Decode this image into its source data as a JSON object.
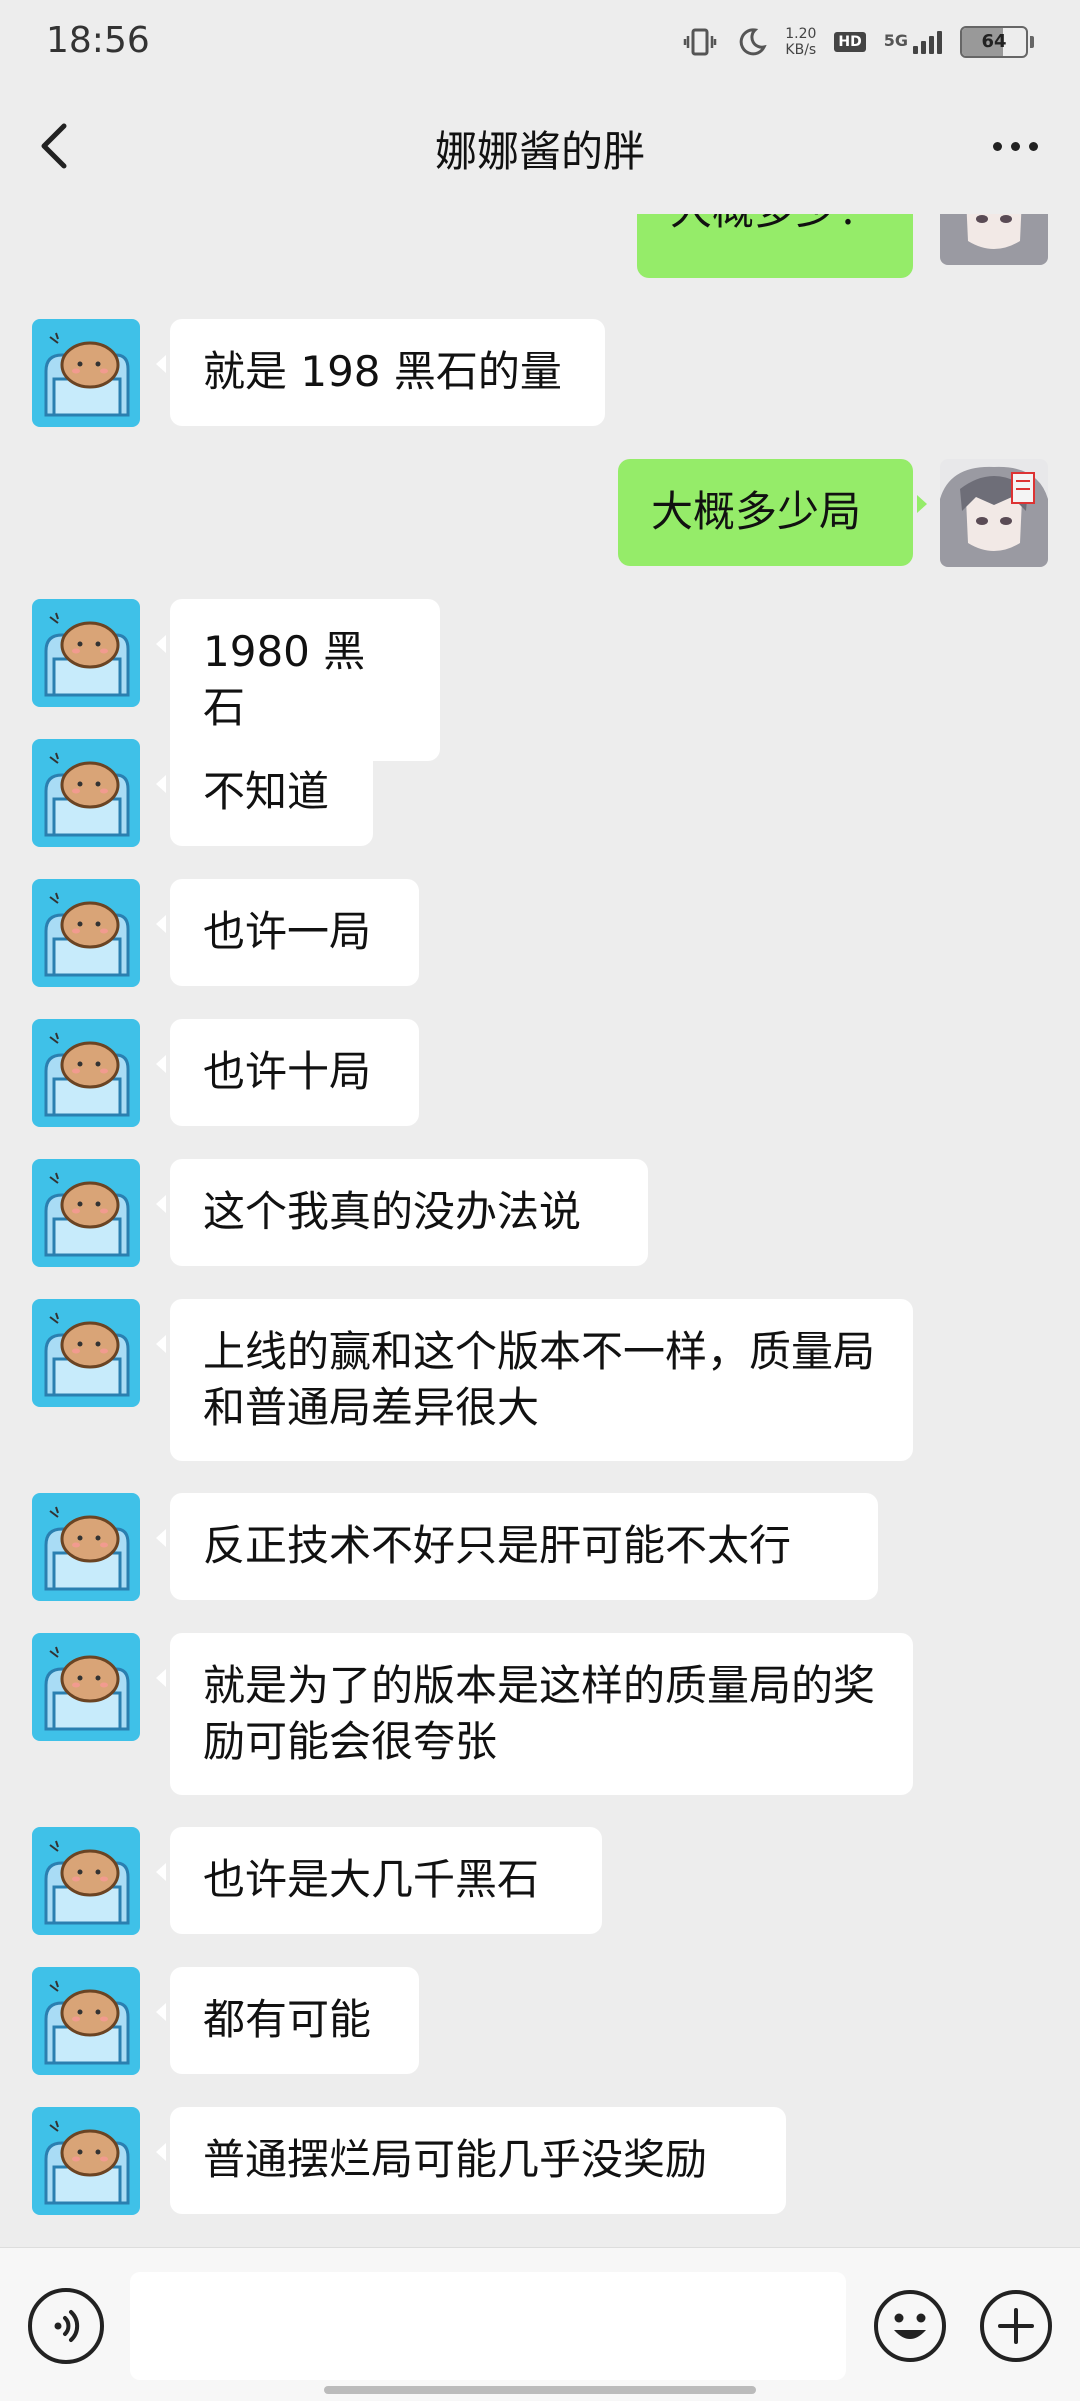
{
  "status": {
    "time": "18:56",
    "speed_value": "1.20",
    "speed_unit": "KB/s",
    "hd": "HD",
    "network": "5G",
    "battery": "64",
    "battery_level": 0.64
  },
  "header": {
    "title": "娜娜酱的胖",
    "back_icon": "chevron-left-icon",
    "more_icon": "more-dots-icon"
  },
  "messages": [
    {
      "side": "out",
      "text": "大概多少？"
    },
    {
      "side": "in",
      "text": "就是 198 黑石的量"
    },
    {
      "side": "out",
      "text": "大概多少局"
    },
    {
      "side": "in",
      "text": "1980 黑石"
    },
    {
      "side": "in",
      "text": "不知道"
    },
    {
      "side": "in",
      "text": "也许一局"
    },
    {
      "side": "in",
      "text": "也许十局"
    },
    {
      "side": "in",
      "text": "这个我真的没办法说"
    },
    {
      "side": "in",
      "text": "上线的赢和这个版本不一样，质量局和普通局差异很大"
    },
    {
      "side": "in",
      "text": "反正技术不好只是肝可能不太行"
    },
    {
      "side": "in",
      "text": "就是为了的版本是这样的质量局的奖励可能会很夸张"
    },
    {
      "side": "in",
      "text": "也许是大几千黑石"
    },
    {
      "side": "in",
      "text": "都有可能"
    },
    {
      "side": "in",
      "text": "普通摆烂局可能几乎没奖励"
    }
  ],
  "input": {
    "value": "",
    "voice_icon": "voice-icon",
    "emoji_icon": "emoji-icon",
    "plus_icon": "plus-icon"
  },
  "colors": {
    "chat_background": "#ededed",
    "incoming_bubble": "#ffffff",
    "outgoing_bubble": "#95ec69",
    "contact_avatar_bg": "#3fc1e8"
  }
}
